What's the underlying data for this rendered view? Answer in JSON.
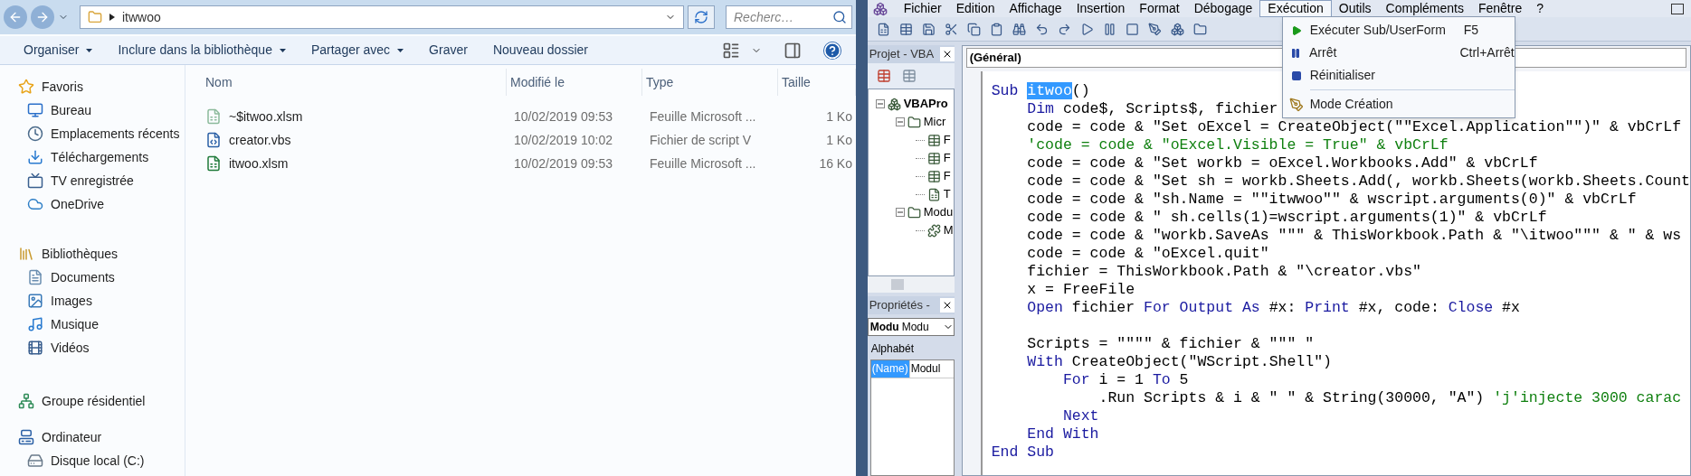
{
  "explorer": {
    "address": {
      "path": "itwwoo",
      "search_placeholder": "Recherc…"
    },
    "toolbar": [
      {
        "label": "Organiser",
        "dropdown": true
      },
      {
        "label": "Inclure dans la bibliothèque",
        "dropdown": true
      },
      {
        "label": "Partager avec",
        "dropdown": true
      },
      {
        "label": "Graver",
        "dropdown": false
      },
      {
        "label": "Nouveau dossier",
        "dropdown": false
      }
    ],
    "nav": [
      {
        "label": "Favoris",
        "kind": "star",
        "children": [
          {
            "label": "Bureau",
            "kind": "desktop"
          },
          {
            "label": "Emplacements récents",
            "kind": "recent"
          },
          {
            "label": "Téléchargements",
            "kind": "download"
          },
          {
            "label": "TV enregistrée",
            "kind": "tv"
          },
          {
            "label": "OneDrive",
            "kind": "cloud"
          }
        ]
      },
      {
        "label": "Bibliothèques",
        "kind": "library",
        "children": [
          {
            "label": "Documents",
            "kind": "document"
          },
          {
            "label": "Images",
            "kind": "image"
          },
          {
            "label": "Musique",
            "kind": "music"
          },
          {
            "label": "Vidéos",
            "kind": "video"
          }
        ]
      },
      {
        "label": "Groupe résidentiel",
        "kind": "network"
      },
      {
        "label": "Ordinateur",
        "kind": "computer",
        "children": [
          {
            "label": "Disque local (C:)",
            "kind": "drive"
          }
        ]
      }
    ],
    "columns": [
      "Nom",
      "Modifié le",
      "Type",
      "Taille"
    ],
    "files": [
      {
        "name": "~$itwoo.xlsm",
        "modified": "10/02/2019 09:53",
        "type": "Feuille Microsoft ...",
        "size": "1 Ko",
        "kind": "excel",
        "hidden": true
      },
      {
        "name": "creator.vbs",
        "modified": "10/02/2019 10:02",
        "type": "Fichier de script V",
        "size": "1 Ko",
        "kind": "script",
        "hidden": false
      },
      {
        "name": "itwoo.xlsm",
        "modified": "10/02/2019 09:53",
        "type": "Feuille Microsoft ...",
        "size": "16 Ko",
        "kind": "excel",
        "hidden": false
      }
    ]
  },
  "vba": {
    "menu": [
      {
        "label": "Fichier",
        "selected": false
      },
      {
        "label": "Edition",
        "selected": false
      },
      {
        "label": "Affichage",
        "selected": false
      },
      {
        "label": "Insertion",
        "selected": false
      },
      {
        "label": "Format",
        "selected": false
      },
      {
        "label": "Débogage",
        "selected": false
      },
      {
        "label": "Exécution",
        "selected": true
      },
      {
        "label": "Outils",
        "selected": false
      },
      {
        "label": "Compléments",
        "selected": false
      },
      {
        "label": "Fenêtre",
        "selected": false
      },
      {
        "label": "?",
        "selected": false
      }
    ],
    "run_menu": [
      {
        "label": "Exécuter Sub/UserForm",
        "shortcut": "F5",
        "kind": "run",
        "separator_above": false
      },
      {
        "label": "Arrêt",
        "shortcut": "Ctrl+Arrêt",
        "kind": "pause",
        "separator_above": false
      },
      {
        "label": "Réinitialiser",
        "kind": "stop",
        "separator_above": false
      },
      {
        "label": "Mode Création",
        "kind": "design",
        "separator_above": true
      }
    ],
    "project": {
      "title": "Projet - VBA",
      "tree": [
        {
          "label": "VBAPro",
          "kind": "project",
          "expanded": true,
          "children": [
            {
              "label": "Micr",
              "kind": "folder",
              "expanded": true,
              "children": [
                {
                  "label": "F",
                  "kind": "sheet"
                },
                {
                  "label": "F",
                  "kind": "sheet"
                },
                {
                  "label": "F",
                  "kind": "sheet"
                },
                {
                  "label": "T",
                  "kind": "workbook"
                }
              ]
            },
            {
              "label": "Modu",
              "kind": "folder",
              "expanded": true,
              "children": [
                {
                  "label": "M",
                  "kind": "module"
                }
              ]
            }
          ]
        }
      ]
    },
    "properties": {
      "title": "Propriétés -",
      "object_name": "Modu",
      "object_type": "Modu",
      "tab": "Alphabét",
      "rows": [
        {
          "name": "(Name)",
          "value": "Modul",
          "selected": true
        }
      ]
    },
    "code": {
      "object_box": "(Général)",
      "lines": [
        {
          "gap_before": false,
          "segments": [
            {
              "kind": "keyword",
              "text": "Sub "
            },
            {
              "kind": "selected",
              "text": "itwoo"
            },
            {
              "kind": "code",
              "text": "()"
            }
          ]
        },
        {
          "gap_before": false,
          "segments": [
            {
              "kind": "keyword",
              "text": "    Dim"
            },
            {
              "kind": "code",
              "text": " code$, Scripts$, fichier"
            }
          ]
        },
        {
          "gap_before": false,
          "segments": [
            {
              "kind": "code",
              "text": "    code = code & \"Set oExcel = CreateObject(\"\"Excel.Application\"\")\" & vbCrLf"
            }
          ]
        },
        {
          "gap_before": false,
          "segments": [
            {
              "kind": "comment",
              "text": "    'code = code & \"oExcel.Visible = True\" & vbCrLf"
            }
          ]
        },
        {
          "gap_before": false,
          "segments": [
            {
              "kind": "code",
              "text": "    code = code & \"Set workb = oExcel.Workbooks.Add\" & vbCrLf"
            }
          ]
        },
        {
          "gap_before": false,
          "segments": [
            {
              "kind": "code",
              "text": "    code = code & \"Set sh = workb.Sheets.Add(, workb.Sheets(workb.Sheets.Count"
            }
          ]
        },
        {
          "gap_before": false,
          "segments": [
            {
              "kind": "code",
              "text": "    code = code & \"sh.Name = \"\"itwwoo\"\" & wscript.arguments(0)\" & vbCrLf"
            }
          ]
        },
        {
          "gap_before": false,
          "segments": [
            {
              "kind": "code",
              "text": "    code = code & \" sh.cells(1)=wscript.arguments(1)\" & vbCrLf"
            }
          ]
        },
        {
          "gap_before": false,
          "segments": [
            {
              "kind": "code",
              "text": "    code = code & \"workb.SaveAs \"\"\" & ThisWorkbook.Path & \"\\itwoo\"\"\" & \" & ws"
            }
          ]
        },
        {
          "gap_before": false,
          "segments": [
            {
              "kind": "code",
              "text": "    code = code & \"oExcel.quit\""
            }
          ]
        },
        {
          "gap_before": false,
          "segments": [
            {
              "kind": "code",
              "text": "    fichier = ThisWorkbook.Path & \"\\creator.vbs\""
            }
          ]
        },
        {
          "gap_before": false,
          "segments": [
            {
              "kind": "code",
              "text": "    x = FreeFile"
            }
          ]
        },
        {
          "gap_before": false,
          "segments": [
            {
              "kind": "keyword",
              "text": "    Open"
            },
            {
              "kind": "code",
              "text": " fichier "
            },
            {
              "kind": "keyword",
              "text": "For Output As"
            },
            {
              "kind": "code",
              "text": " #x: "
            },
            {
              "kind": "keyword",
              "text": "Print"
            },
            {
              "kind": "code",
              "text": " #x, code: "
            },
            {
              "kind": "keyword",
              "text": "Close"
            },
            {
              "kind": "code",
              "text": " #x"
            }
          ]
        },
        {
          "gap_before": true,
          "segments": [
            {
              "kind": "code",
              "text": "    Scripts = \"\"\"\" & fichier & \"\"\" \""
            }
          ]
        },
        {
          "gap_before": false,
          "segments": [
            {
              "kind": "keyword",
              "text": "    With"
            },
            {
              "kind": "code",
              "text": " CreateObject(\"WScript.Shell\")"
            }
          ]
        },
        {
          "gap_before": false,
          "segments": [
            {
              "kind": "keyword",
              "text": "        For"
            },
            {
              "kind": "code",
              "text": " i = 1 "
            },
            {
              "kind": "keyword",
              "text": "To"
            },
            {
              "kind": "code",
              "text": " 5"
            }
          ]
        },
        {
          "gap_before": false,
          "segments": [
            {
              "kind": "code",
              "text": "            .Run Scripts & i & \" \" & String(30000, \"A\") "
            },
            {
              "kind": "comment",
              "text": "'j'injecte 3000 carac"
            }
          ]
        },
        {
          "gap_before": false,
          "segments": [
            {
              "kind": "keyword",
              "text": "        Next"
            }
          ]
        },
        {
          "gap_before": false,
          "segments": [
            {
              "kind": "keyword",
              "text": "    End With"
            }
          ]
        },
        {
          "gap_before": false,
          "segments": [
            {
              "kind": "keyword",
              "text": "End Sub"
            }
          ]
        }
      ]
    }
  }
}
